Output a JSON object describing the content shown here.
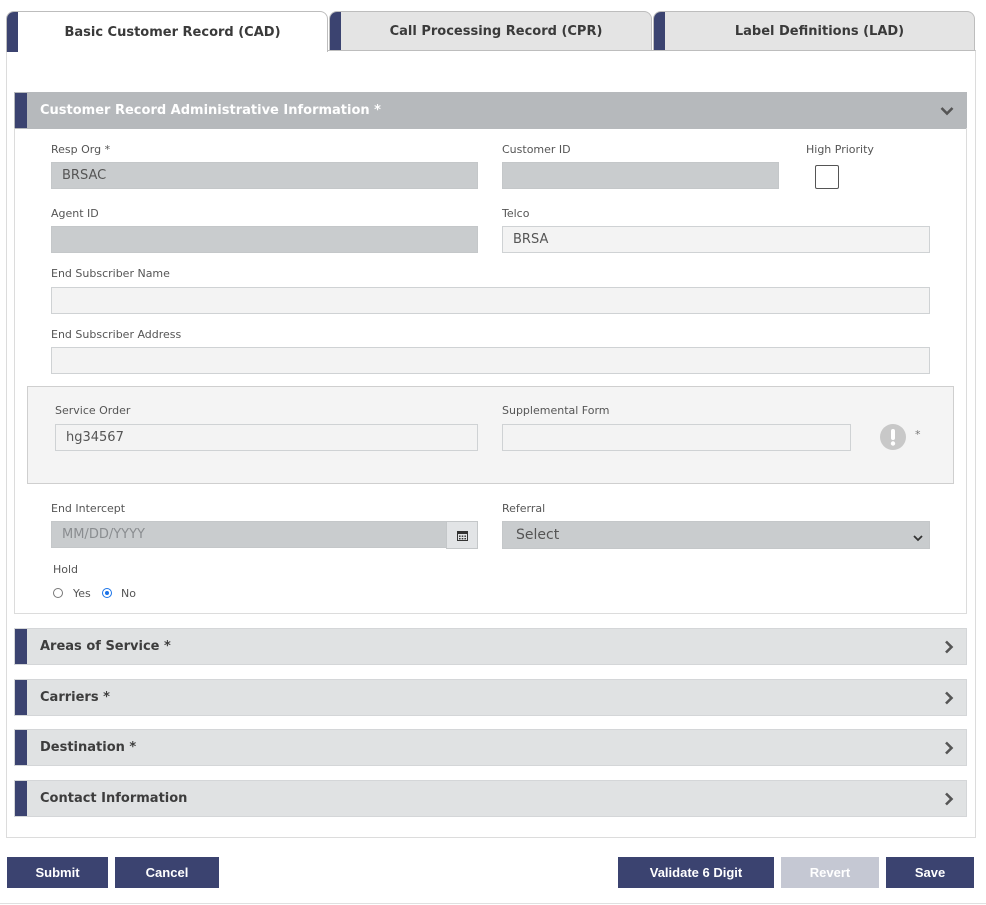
{
  "tabs": [
    {
      "label": "Basic Customer Record (CAD)",
      "active": true
    },
    {
      "label": "Call Processing Record (CPR)",
      "active": false
    },
    {
      "label": "Label Definitions (LAD)",
      "active": false
    }
  ],
  "sections": {
    "admin": {
      "title": "Customer Record Administrative Information *"
    },
    "areas": {
      "title": "Areas of Service *"
    },
    "carriers": {
      "title": "Carriers *"
    },
    "destination": {
      "title": "Destination *"
    },
    "contact": {
      "title": "Contact Information"
    }
  },
  "form": {
    "resp_org": {
      "label": "Resp Org *",
      "value": "BRSAC"
    },
    "customer_id": {
      "label": "Customer ID",
      "value": ""
    },
    "high_priority": {
      "label": "High Priority",
      "checked": false
    },
    "agent_id": {
      "label": "Agent ID",
      "value": ""
    },
    "telco": {
      "label": "Telco",
      "value": "BRSA"
    },
    "end_sub_name": {
      "label": "End Subscriber Name",
      "value": ""
    },
    "end_sub_address": {
      "label": "End Subscriber Address",
      "value": ""
    },
    "service_order": {
      "label": "Service Order",
      "value": "hg34567"
    },
    "supplemental_form": {
      "label": "Supplemental Form",
      "value": "",
      "required_mark": "*"
    },
    "end_intercept": {
      "label": "End Intercept",
      "placeholder": "MM/DD/YYYY"
    },
    "referral": {
      "label": "Referral",
      "selected": "Select"
    },
    "hold": {
      "label": "Hold",
      "options": [
        "Yes",
        "No"
      ],
      "selected": "No"
    }
  },
  "buttons": {
    "submit": "Submit",
    "cancel": "Cancel",
    "validate": "Validate 6 Digit",
    "revert": "Revert",
    "save": "Save"
  },
  "colors": {
    "accent": "#3b4370",
    "header_active": "#b6b9bc",
    "header": "#e0e2e3",
    "disabled": "#c5c8d3"
  }
}
